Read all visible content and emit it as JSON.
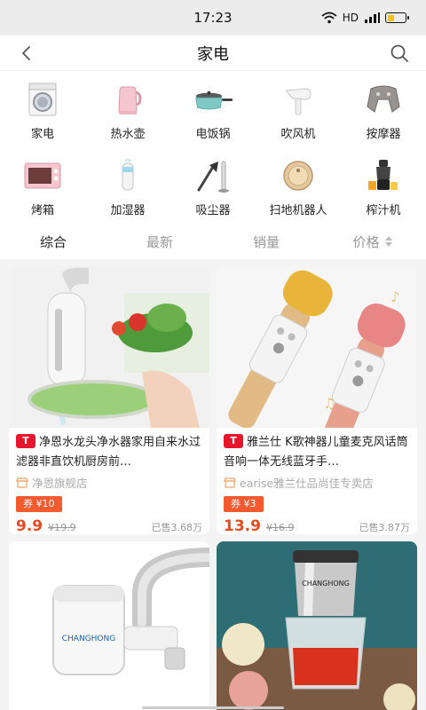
{
  "status": {
    "time": "17:23",
    "network": "HD"
  },
  "navbar": {
    "title": "家电"
  },
  "categories": [
    {
      "label": "家电",
      "icon": "washing-machine-icon"
    },
    {
      "label": "热水壶",
      "icon": "kettle-icon"
    },
    {
      "label": "电饭锅",
      "icon": "pot-icon"
    },
    {
      "label": "吹风机",
      "icon": "hair-dryer-icon"
    },
    {
      "label": "按摩器",
      "icon": "massager-icon"
    },
    {
      "label": "烤箱",
      "icon": "oven-icon"
    },
    {
      "label": "加湿器",
      "icon": "humidifier-icon"
    },
    {
      "label": "吸尘器",
      "icon": "vacuum-icon"
    },
    {
      "label": "扫地机器人",
      "icon": "robot-vacuum-icon"
    },
    {
      "label": "榨汁机",
      "icon": "juicer-icon"
    }
  ],
  "sort": {
    "tabs": [
      "综合",
      "最新",
      "销量",
      "价格"
    ],
    "active": "综合"
  },
  "products": [
    {
      "name": "净恩水龙头净水器家用自来水过滤器非直饮机厨房前…",
      "shop": "净恩旗舰店",
      "coupon": "券 ¥10",
      "price": "9.9",
      "original_price": "¥19.9",
      "sold": "已售3.68万"
    },
    {
      "name": "雅兰仕 K歌神器儿童麦克风话筒音响一体无线蓝牙手…",
      "shop": "earise雅兰仕品尚佳专卖店",
      "coupon": "券 ¥3",
      "price": "13.9",
      "original_price": "¥16.9",
      "sold": "已售3.87万"
    },
    {
      "brand_text": "CHANGHONG"
    },
    {
      "brand_text": "CHANGHONG"
    }
  ],
  "colors": {
    "accent": "#e64b1f",
    "coupon": "#f45a30",
    "tmall": "#e6162d"
  }
}
